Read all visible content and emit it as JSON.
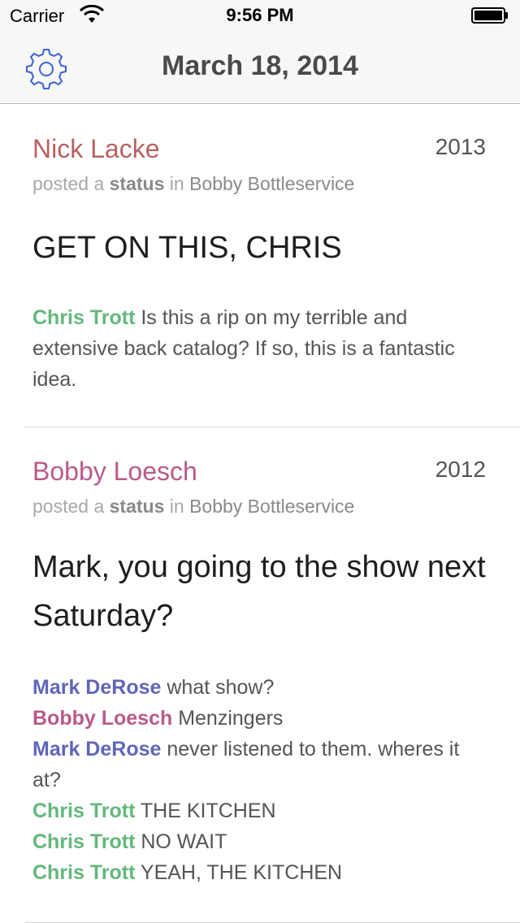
{
  "status_bar": {
    "carrier": "Carrier",
    "time": "9:56 PM",
    "wifi_icon": "wifi-icon",
    "battery_icon": "battery-icon"
  },
  "nav": {
    "title": "March 18, 2014",
    "settings_icon": "gear-icon"
  },
  "colors": {
    "nick": "#b86060",
    "bobby": "#b85a8a",
    "chris": "#63b87c",
    "mark": "#5f66b8"
  },
  "posts": [
    {
      "author": "Nick Lacke",
      "year": "2013",
      "meta_posted": "posted a",
      "meta_type": "status",
      "meta_in": "in",
      "meta_group": "Bobby Bottleservice",
      "headline": "GET ON THIS, CHRIS",
      "comments": [
        {
          "who": "Chris Trott",
          "text": "Is this a rip on my terrible and extensive back catalog? If so, this is a fantastic idea."
        }
      ]
    },
    {
      "author": "Bobby Loesch",
      "year": "2012",
      "meta_posted": "posted a",
      "meta_type": "status",
      "meta_in": "in",
      "meta_group": "Bobby Bottleservice",
      "headline": "Mark, you going to the show next Saturday?",
      "comments": [
        {
          "who": "Mark DeRose",
          "text": "what show?"
        },
        {
          "who": "Bobby Loesch",
          "text": "Menzingers"
        },
        {
          "who": "Mark DeRose",
          "text": "never listened to them. wheres it at?"
        },
        {
          "who": "Chris Trott",
          "text": "THE KITCHEN"
        },
        {
          "who": "Chris Trott",
          "text": "NO WAIT"
        },
        {
          "who": "Chris Trott",
          "text": "YEAH, THE KITCHEN"
        }
      ]
    }
  ]
}
